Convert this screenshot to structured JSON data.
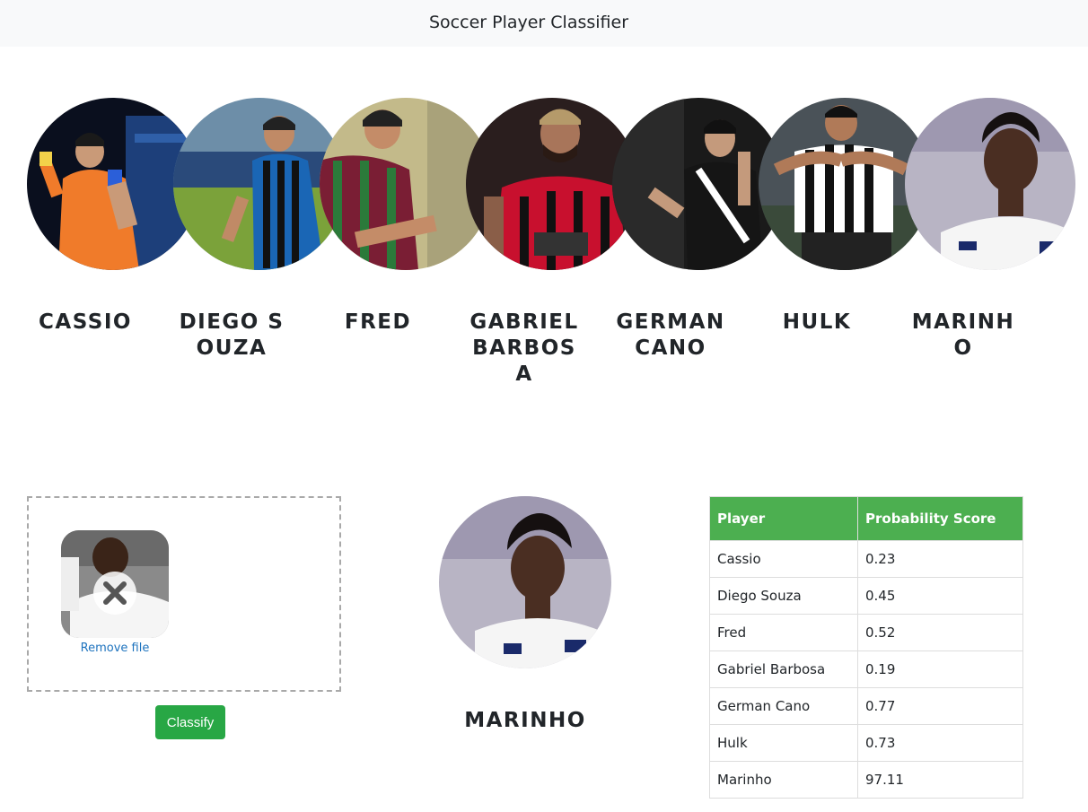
{
  "navbar": {
    "title": "Soccer Player Classifier"
  },
  "players": [
    {
      "name": "CASSIO"
    },
    {
      "name": "DIEGO SOUZA"
    },
    {
      "name": "FRED"
    },
    {
      "name": "GABRIEL BARBOSA"
    },
    {
      "name": "GERMAN CANO"
    },
    {
      "name": "HULK"
    },
    {
      "name": "MARINHO"
    }
  ],
  "upload": {
    "remove_label": "Remove file",
    "classify_label": "Classify"
  },
  "result": {
    "name": "MARINHO"
  },
  "table": {
    "headers": [
      "Player",
      "Probability Score"
    ],
    "rows": [
      [
        "Cassio",
        "0.23"
      ],
      [
        "Diego Souza",
        "0.45"
      ],
      [
        "Fred",
        "0.52"
      ],
      [
        "Gabriel Barbosa",
        "0.19"
      ],
      [
        "German Cano",
        "0.77"
      ],
      [
        "Hulk",
        "0.73"
      ],
      [
        "Marinho",
        "97.11"
      ]
    ]
  }
}
